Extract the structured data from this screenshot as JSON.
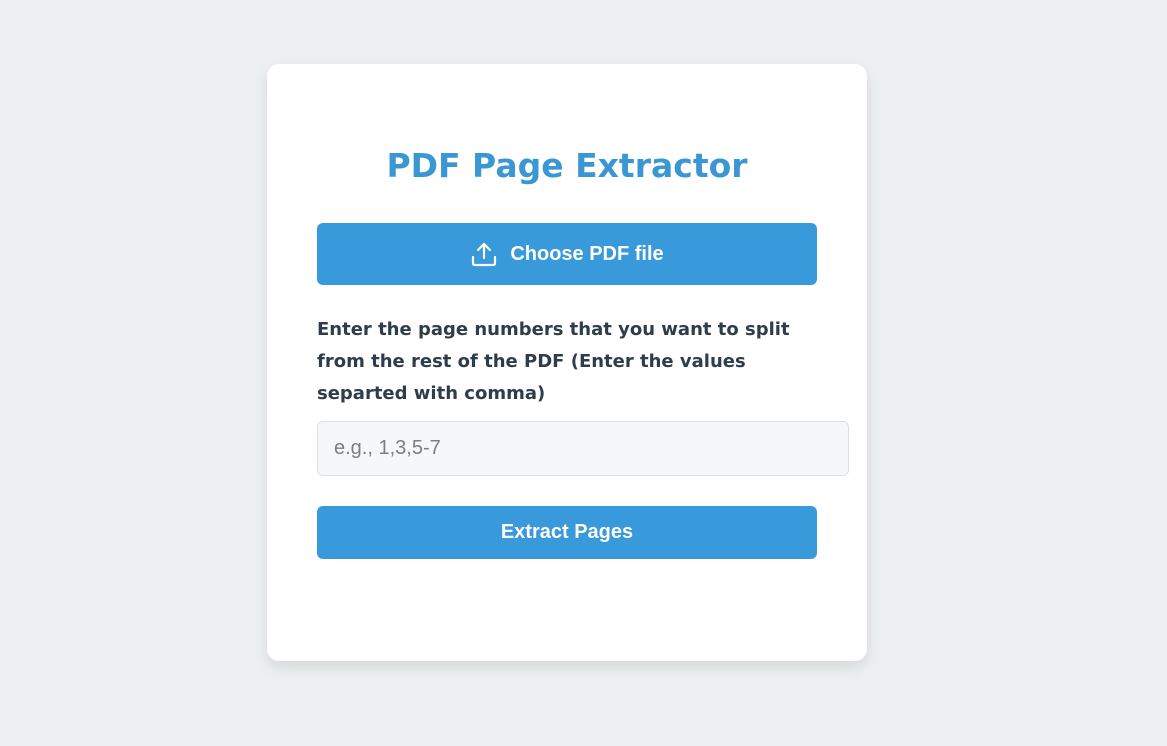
{
  "app": {
    "title": "PDF Page Extractor"
  },
  "upload": {
    "label": "Choose PDF file",
    "icon": "upload-icon"
  },
  "pages": {
    "instructions": "Enter the page numbers that you want to split from the rest of the PDF (Enter the values separted with comma)",
    "placeholder": "e.g., 1,3,5-7",
    "value": ""
  },
  "actions": {
    "extract_label": "Extract Pages"
  },
  "colors": {
    "accent": "#3899db",
    "title": "#3a97d4",
    "background": "#ecf0f1",
    "card": "#ffffff",
    "text": "#2f3d48"
  }
}
